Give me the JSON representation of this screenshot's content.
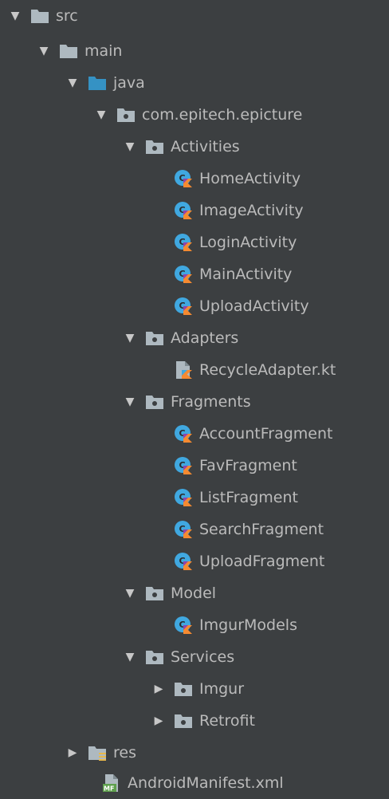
{
  "colors": {
    "background": "#3c3f41",
    "folder_gray": "#aeb9c0",
    "folder_blue": "#3592c4",
    "kotlin_class_blue": "#40a8e0",
    "kotlin_class_orange": "#f58a31",
    "text": "#bbbbbb"
  },
  "tree": [
    {
      "label": "src",
      "arrow": "expanded",
      "icon": "folder-icon"
    },
    {
      "label": "main",
      "arrow": "expanded",
      "icon": "folder-icon"
    },
    {
      "label": "java",
      "arrow": "expanded",
      "icon": "source-folder-icon"
    },
    {
      "label": "com.epitech.epicture",
      "arrow": "expanded",
      "icon": "package-icon"
    },
    {
      "label": "Activities",
      "arrow": "expanded",
      "icon": "package-icon"
    },
    {
      "label": "HomeActivity",
      "arrow": "none",
      "icon": "kotlin-class-icon"
    },
    {
      "label": "ImageActivity",
      "arrow": "none",
      "icon": "kotlin-class-icon"
    },
    {
      "label": "LoginActivity",
      "arrow": "none",
      "icon": "kotlin-class-icon"
    },
    {
      "label": "MainActivity",
      "arrow": "none",
      "icon": "kotlin-class-icon"
    },
    {
      "label": "UploadActivity",
      "arrow": "none",
      "icon": "kotlin-class-icon"
    },
    {
      "label": "Adapters",
      "arrow": "expanded",
      "icon": "package-icon"
    },
    {
      "label": "RecycleAdapter.kt",
      "arrow": "none",
      "icon": "kotlin-file-icon"
    },
    {
      "label": "Fragments",
      "arrow": "expanded",
      "icon": "package-icon"
    },
    {
      "label": "AccountFragment",
      "arrow": "none",
      "icon": "kotlin-class-icon"
    },
    {
      "label": "FavFragment",
      "arrow": "none",
      "icon": "kotlin-class-icon"
    },
    {
      "label": "ListFragment",
      "arrow": "none",
      "icon": "kotlin-class-icon"
    },
    {
      "label": "SearchFragment",
      "arrow": "none",
      "icon": "kotlin-class-icon"
    },
    {
      "label": "UploadFragment",
      "arrow": "none",
      "icon": "kotlin-class-icon"
    },
    {
      "label": "Model",
      "arrow": "expanded",
      "icon": "package-icon"
    },
    {
      "label": "ImgurModels",
      "arrow": "none",
      "icon": "kotlin-class-icon"
    },
    {
      "label": "Services",
      "arrow": "expanded",
      "icon": "package-icon"
    },
    {
      "label": "Imgur",
      "arrow": "collapsed",
      "icon": "package-icon"
    },
    {
      "label": "Retrofit",
      "arrow": "collapsed",
      "icon": "package-icon"
    },
    {
      "label": "res",
      "arrow": "collapsed",
      "icon": "resource-folder-icon"
    },
    {
      "label": "AndroidManifest.xml",
      "arrow": "none",
      "icon": "manifest-file-icon"
    }
  ]
}
